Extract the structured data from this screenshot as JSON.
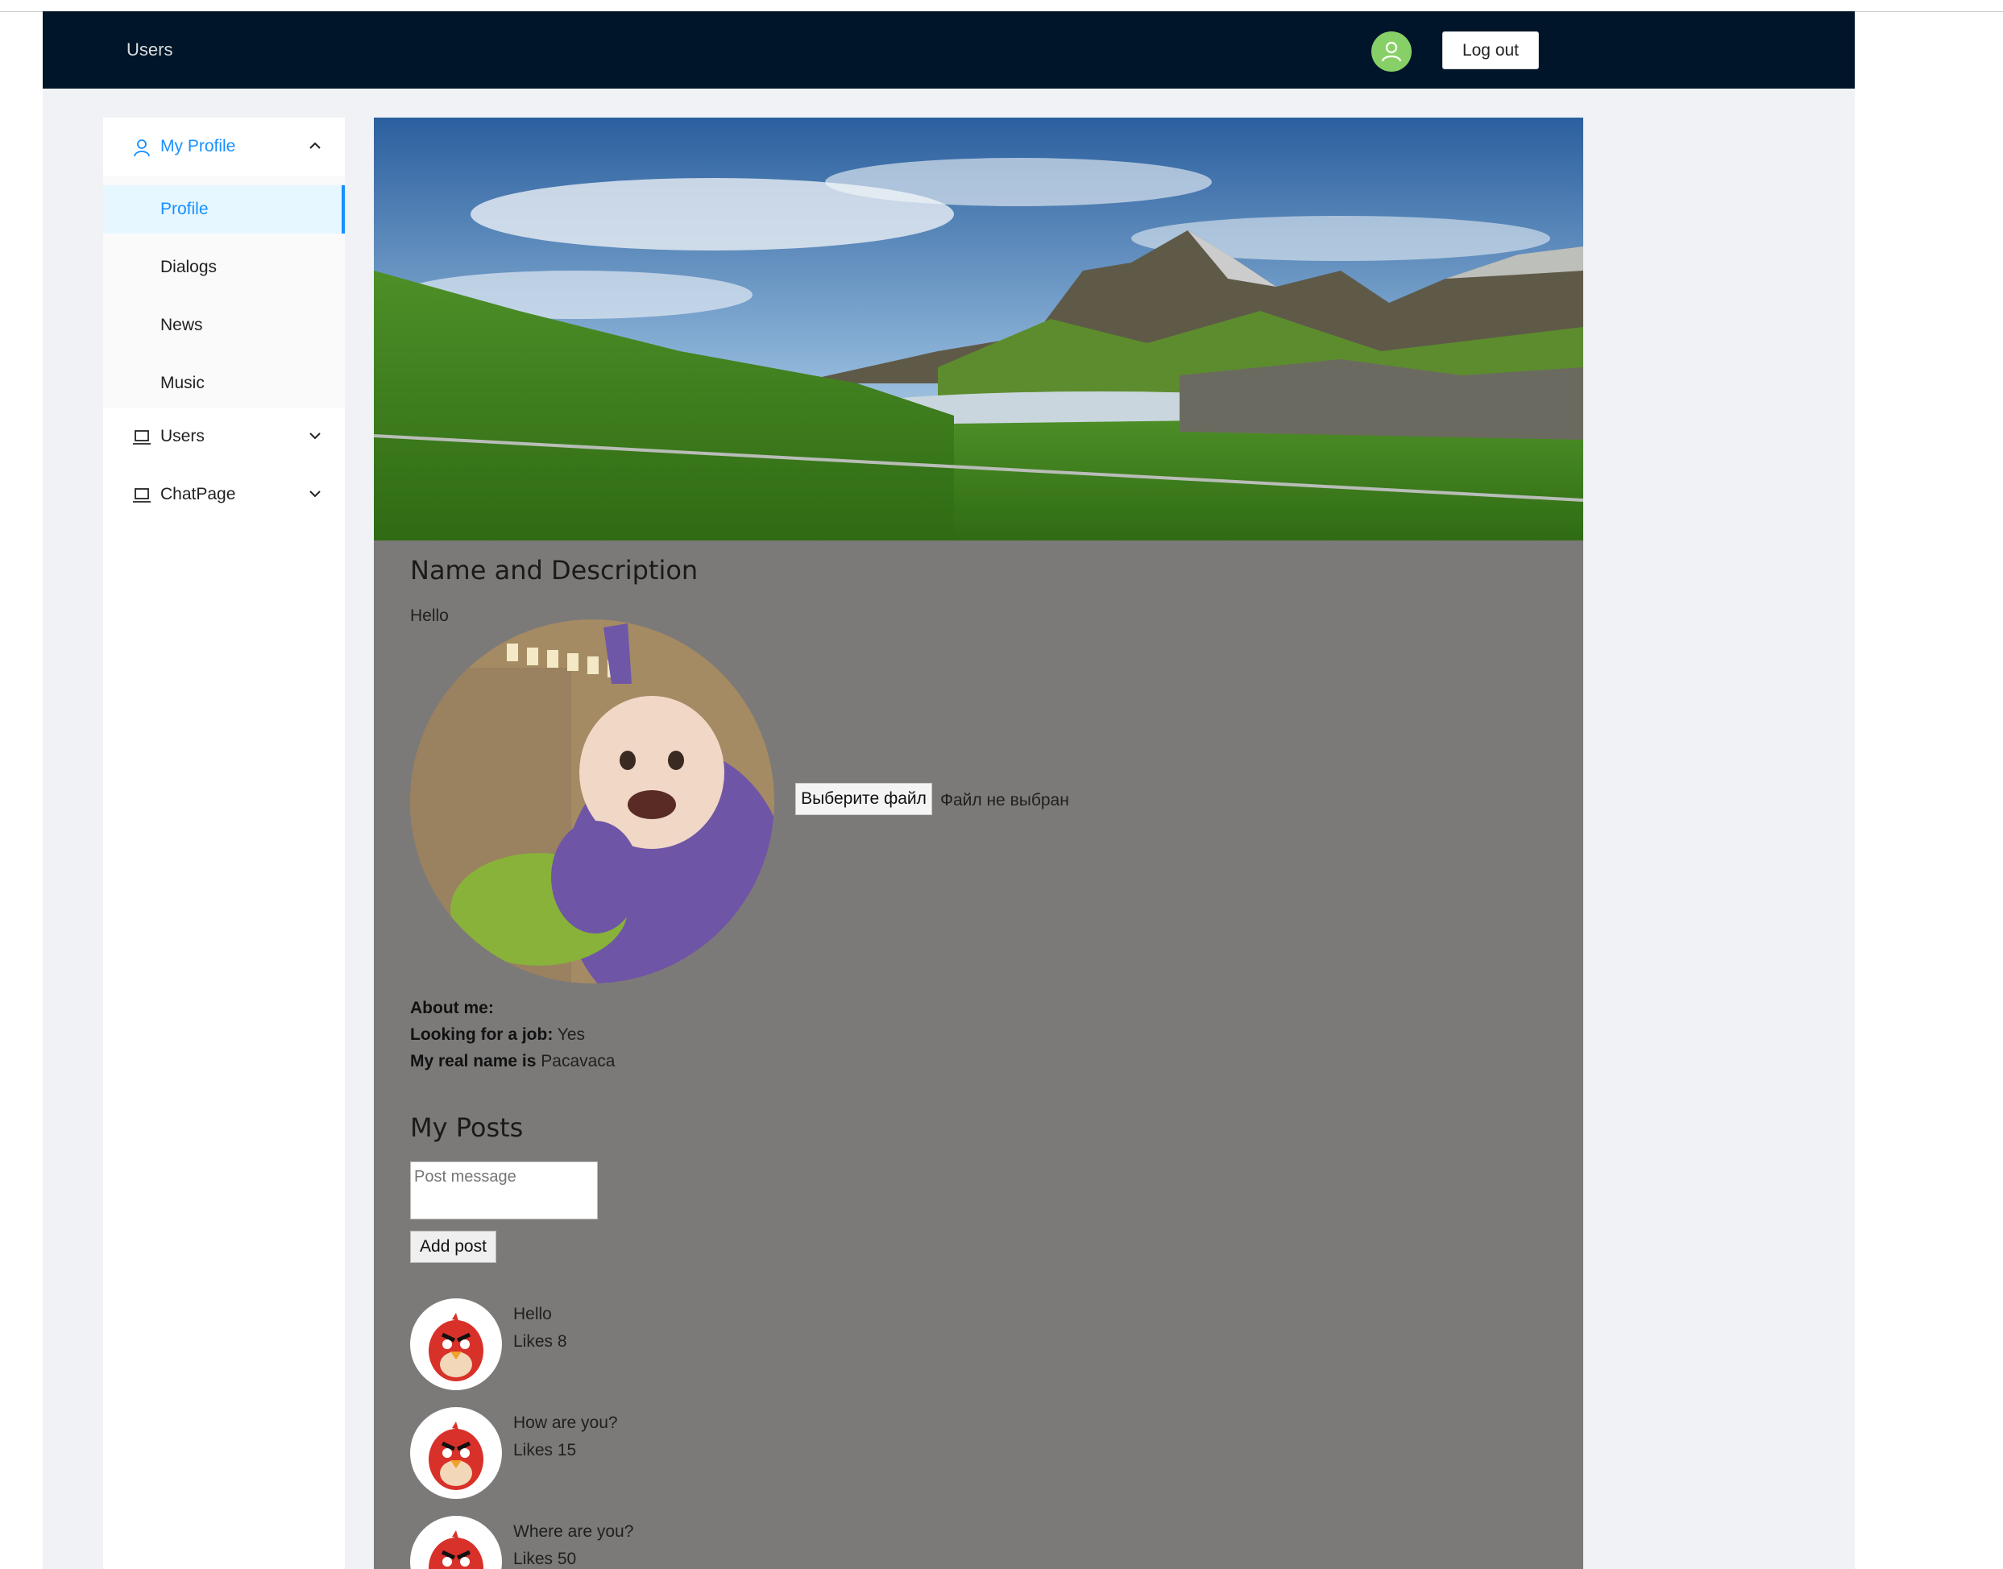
{
  "header": {
    "nav_label": "Users",
    "logout_label": "Log out",
    "avatar_color": "#87d068",
    "avatar_icon": "user-icon",
    "background": "#001529"
  },
  "sidebar": {
    "my_profile": {
      "label": "My Profile",
      "icon": "user-icon",
      "expanded": true,
      "items": [
        {
          "label": "Profile",
          "active": true
        },
        {
          "label": "Dialogs"
        },
        {
          "label": "News"
        },
        {
          "label": "Music"
        }
      ]
    },
    "users": {
      "label": "Users",
      "icon": "laptop-icon"
    },
    "chat": {
      "label": "ChatPage",
      "icon": "laptop-icon"
    },
    "accent_color": "#1890ff"
  },
  "profile": {
    "section_title": "Name and Description",
    "status": "Hello",
    "file_button": "Выберите файл",
    "file_status": "Файл не выбран",
    "about_label": "About me:",
    "about_value": "",
    "job_label": "Looking for a job:",
    "job_value": "Yes",
    "name_label": "My real name is",
    "name_value": "Pacavaca"
  },
  "posts": {
    "title": "My Posts",
    "placeholder": "Post message",
    "add_label": "Add post",
    "items": [
      {
        "message": "Hello",
        "likes": "Likes 8"
      },
      {
        "message": "How are you?",
        "likes": "Likes 15"
      },
      {
        "message": "Where are you?",
        "likes": "Likes 50"
      }
    ]
  }
}
